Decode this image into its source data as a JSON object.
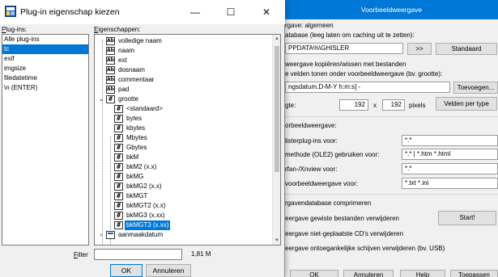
{
  "dialog": {
    "title": "Plug-in eigenschap kiezen",
    "minimize": "—",
    "maximize": "☐",
    "close": "✕",
    "plugins_label_first": "P",
    "plugins_label_rest": "lug-ins:",
    "fields_label_first": "E",
    "fields_label_rest": "igenschappen:",
    "plugins": [
      "Alle plug-ins",
      "tc",
      "exif",
      "imgsize",
      "filedatetime",
      "\\n (ENTER)"
    ],
    "selected_plugin_index": 1,
    "fields": {
      "volledige_naam": "volledige naam",
      "naam": "naam",
      "ext": "ext",
      "dosnaam": "dosnaam",
      "commentaar": "commentaar",
      "pad": "pad",
      "grootte": "grootte",
      "standaard": "<standaard>",
      "bytes": "bytes",
      "kbytes": "kbytes",
      "Mbytes": "Mbytes",
      "Gbytes": "Gbytes",
      "bkM": "bkM",
      "bkM2": "bkM2 (x.x)",
      "bkMG": "bkMG",
      "bkMG2": "bkMG2 (x.x)",
      "bkMGT": "bkMGT",
      "bkMGT2": "bkMGT2 (x.x)",
      "bkMG3": "bkMG3 (x.xx)",
      "bkMGT3": "bkMGT3 (x.xx)",
      "aanmaakdatum": "aanmaakdatum"
    },
    "filter_label_first": "F",
    "filter_label_rest": "ilter",
    "filter_value": "",
    "size_readout": "1,81 M",
    "ok": "OK",
    "cancel": "Annuleren"
  },
  "background": {
    "title": "Voorbeeldweergave",
    "r1": "rgave: algemeen",
    "r2": "atabase (leeg laten om caching uit te zetten):",
    "db_path": "PPDATA%\\GHISLER",
    "browse": ">>",
    "standaard": "Standaard",
    "r3": "weergave kopiëren/wissen met bestanden",
    "r4": "e velden tonen onder voorbeeldweergave (bv. grootte):",
    "fields_value": "ngsdatum.D-M-Y h:m:s] -",
    "toevoegen": "Toevoegen...",
    "r5": "gte:",
    "w": "192",
    "x": "x",
    "h": "192",
    "pixels": "pixels",
    "velden_per_type": "Velden per type",
    "r6": "orbeeldweergave:",
    "r7": "listerplug-ins voor:",
    "v7": "*.*",
    "r8": "methode (OLE2) gebruiken voor:",
    "v8": "*.* | *.htm *.html",
    "r9": "rfan-/Xnview voor:",
    "v9": "*.*",
    "r10": "voorbeeldweergave voor:",
    "v10": "*.txt *.ini",
    "r11": "rgavendatabase comprimeren",
    "r12": "eergave gewiste bestanden verwijderen",
    "start": "Start!",
    "r13": "eergave niet-geplaatste CD's verwijderen",
    "r14": "eergave ontoegankelijke schijven verwijderen (bv. USB)",
    "b_ok": "OK",
    "b_cancel": "Annuleren",
    "b_help": "Help",
    "b_apply": "Toepassen"
  }
}
